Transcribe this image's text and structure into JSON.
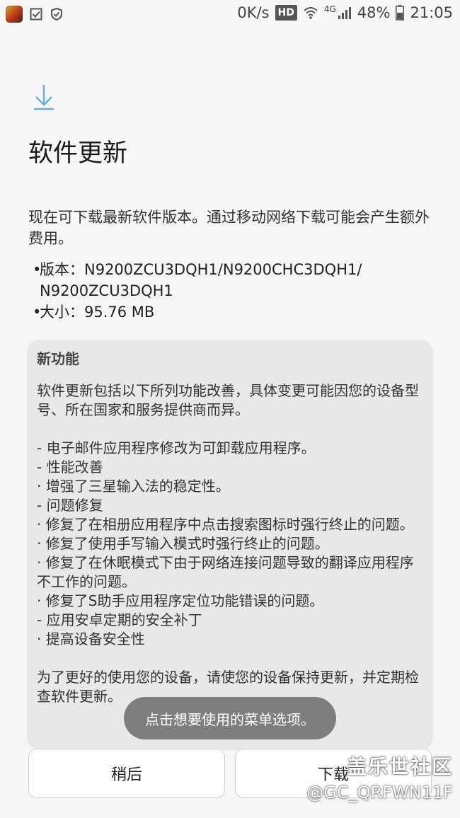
{
  "status_bar": {
    "net_speed": "0K/s",
    "hd_badge": "HD",
    "network_type": "4G",
    "battery": "48%",
    "time": "21:05",
    "icons": [
      "app-icon",
      "checkbox-icon",
      "shield-icon",
      "wifi-icon",
      "signal-icon",
      "battery-icon"
    ]
  },
  "header": {
    "icon": "download-icon",
    "title": "软件更新"
  },
  "intro_text": "现在可下载最新软件版本。通过移动网络下载可能会产生额外费用。",
  "info": {
    "version_label": "版本：",
    "version_value": "N9200ZCU3DQH1/N9200CHC3DQH1/ N9200ZCU3DQH1",
    "size_label": "大小：",
    "size_value": "95.76 MB"
  },
  "notes": {
    "title": "新功能",
    "lines": [
      "软件更新包括以下所列功能改善，具体变更可能因您的设备型号、所在国家和服务提供商而异。",
      "",
      "- 电子邮件应用程序修改为可卸载应用程序。",
      "- 性能改善",
      " · 增强了三星输入法的稳定性。",
      "- 问题修复",
      " · 修复了在相册应用程序中点击搜索图标时强行终止的问题。",
      " · 修复了使用手写输入模式时强行终止的问题。",
      " · 修复了在休眠模式下由于网络连接问题导致的翻译应用程序不工作的问题。",
      " · 修复了S助手应用程序定位功能错误的问题。",
      "- 应用安卓定期的安全补丁",
      " · 提高设备安全性",
      "",
      "为了更好的使用您的设备，请使您的设备保持更新，并定期检查软件更新。"
    ]
  },
  "buttons": {
    "later": "稍后",
    "download": "下载"
  },
  "toast": "点击想要使用的菜单选项。",
  "watermark": {
    "brand": "盖乐世社区",
    "user": "@GC_QRFWN11F"
  },
  "colors": {
    "accent": "#5bb6d9",
    "background": "#f6f6f6",
    "card": "#e8e8e8"
  }
}
